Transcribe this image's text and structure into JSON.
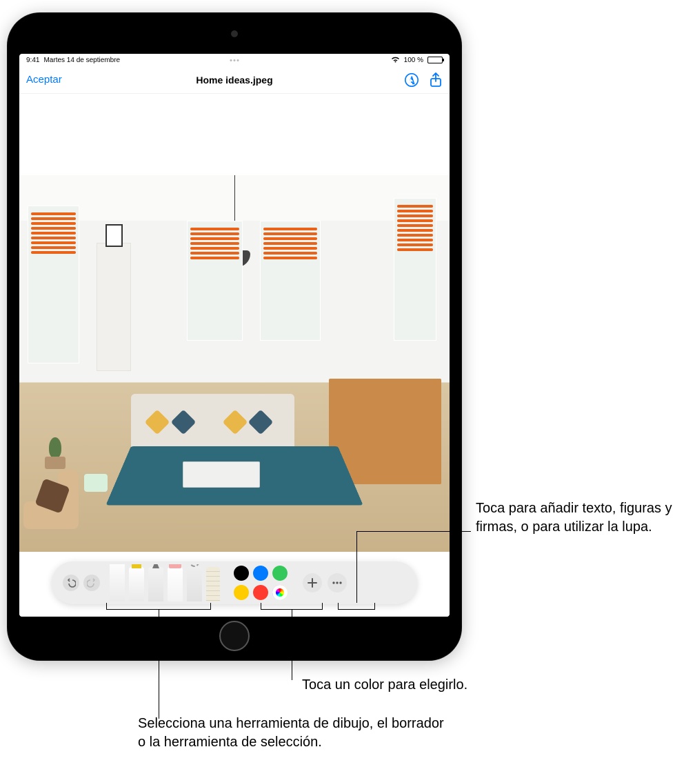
{
  "status": {
    "time": "9:41",
    "date": "Martes 14 de septiembre",
    "battery_pct": "100 %",
    "wifi": true
  },
  "nav": {
    "accept": "Aceptar",
    "title": "Home ideas.jpeg"
  },
  "toolbar": {
    "tools": [
      "pen",
      "marker",
      "pencil",
      "eraser",
      "lasso",
      "ruler"
    ],
    "selected": "pen",
    "colors": {
      "black": "#000000",
      "blue": "#007aff",
      "green": "#34c759",
      "yellow": "#ffcc00",
      "red": "#ff3b30",
      "wheel": "multicolor"
    }
  },
  "callouts": {
    "add": "Toca para añadir texto, figuras y firmas, o para utilizar la lupa.",
    "color": "Toca un color para elegirlo.",
    "tool": "Selecciona una herramienta de dibujo, el borrador o la herramienta de selección."
  }
}
